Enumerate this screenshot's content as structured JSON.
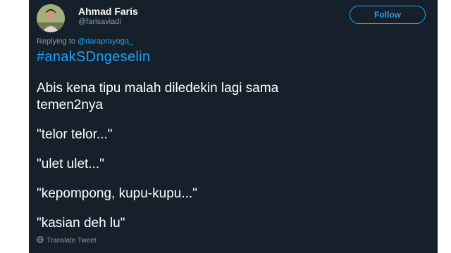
{
  "tweet": {
    "author_name": "Ahmad Faris",
    "author_handle": "@farisaviadi",
    "follow_label": "Follow",
    "replying_prefix": "Replying to",
    "replying_to": "@daraprayoga_",
    "hashtag": "#anakSDngeselin",
    "lines": [
      "Abis kena tipu malah diledekin lagi sama",
      "temen2nya",
      "\"telor telor...\"",
      "\"ulet ulet...\"",
      "\"kepompong, kupu-kupu...\"",
      "\"kasian deh lu\""
    ],
    "translate_label": "Translate Tweet"
  },
  "colors": {
    "background": "#15202b",
    "accent": "#1da1f2",
    "secondary_text": "#8899a6"
  },
  "icons": {
    "translate": "globe-icon"
  }
}
